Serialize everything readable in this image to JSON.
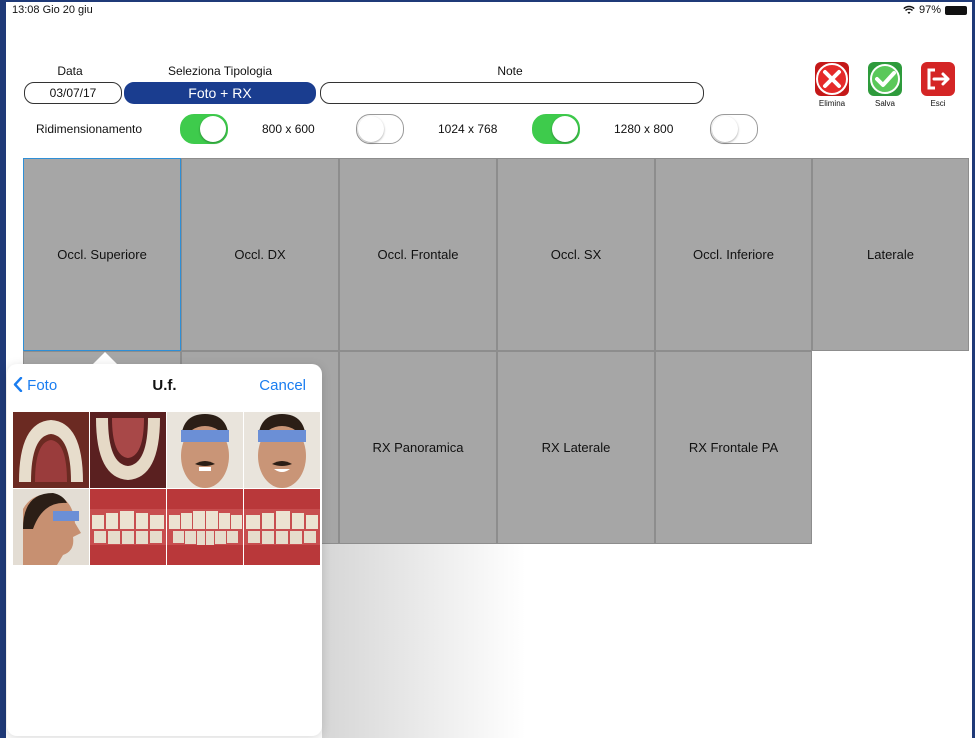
{
  "status": {
    "time": "13:08  Gio 20 giu",
    "battery": "97%"
  },
  "form": {
    "data_label": "Data",
    "data_value": "03/07/17",
    "tipologia_label": "Seleziona Tipologia",
    "tipologia_value": "Foto + RX",
    "note_label": "Note",
    "note_value": ""
  },
  "resize": {
    "label": "Ridimensionamento",
    "master_on": true,
    "options": [
      {
        "label": "800 x 600",
        "on": false
      },
      {
        "label": "1024 x 768",
        "on": true
      },
      {
        "label": "1280 x 800",
        "on": false
      }
    ]
  },
  "actions": {
    "delete_label": "Elimina",
    "save_label": "Salva",
    "exit_label": "Esci"
  },
  "tiles": {
    "row1": [
      "Occl. Superiore",
      "Occl. DX",
      "Occl. Frontale",
      "Occl. SX",
      "Occl. Inferiore",
      "Laterale"
    ],
    "row2": [
      "RX Panoramica",
      "RX Laterale",
      "RX Frontale PA"
    ]
  },
  "picker": {
    "back_label": "Foto",
    "title": "U.f.",
    "cancel_label": "Cancel",
    "thumb_count": 8
  },
  "colors": {
    "accent_blue": "#1a3d8f",
    "toggle_on": "#3ecb4c",
    "tile_grey": "#a6a6a6",
    "ios_link": "#1a7df0"
  }
}
